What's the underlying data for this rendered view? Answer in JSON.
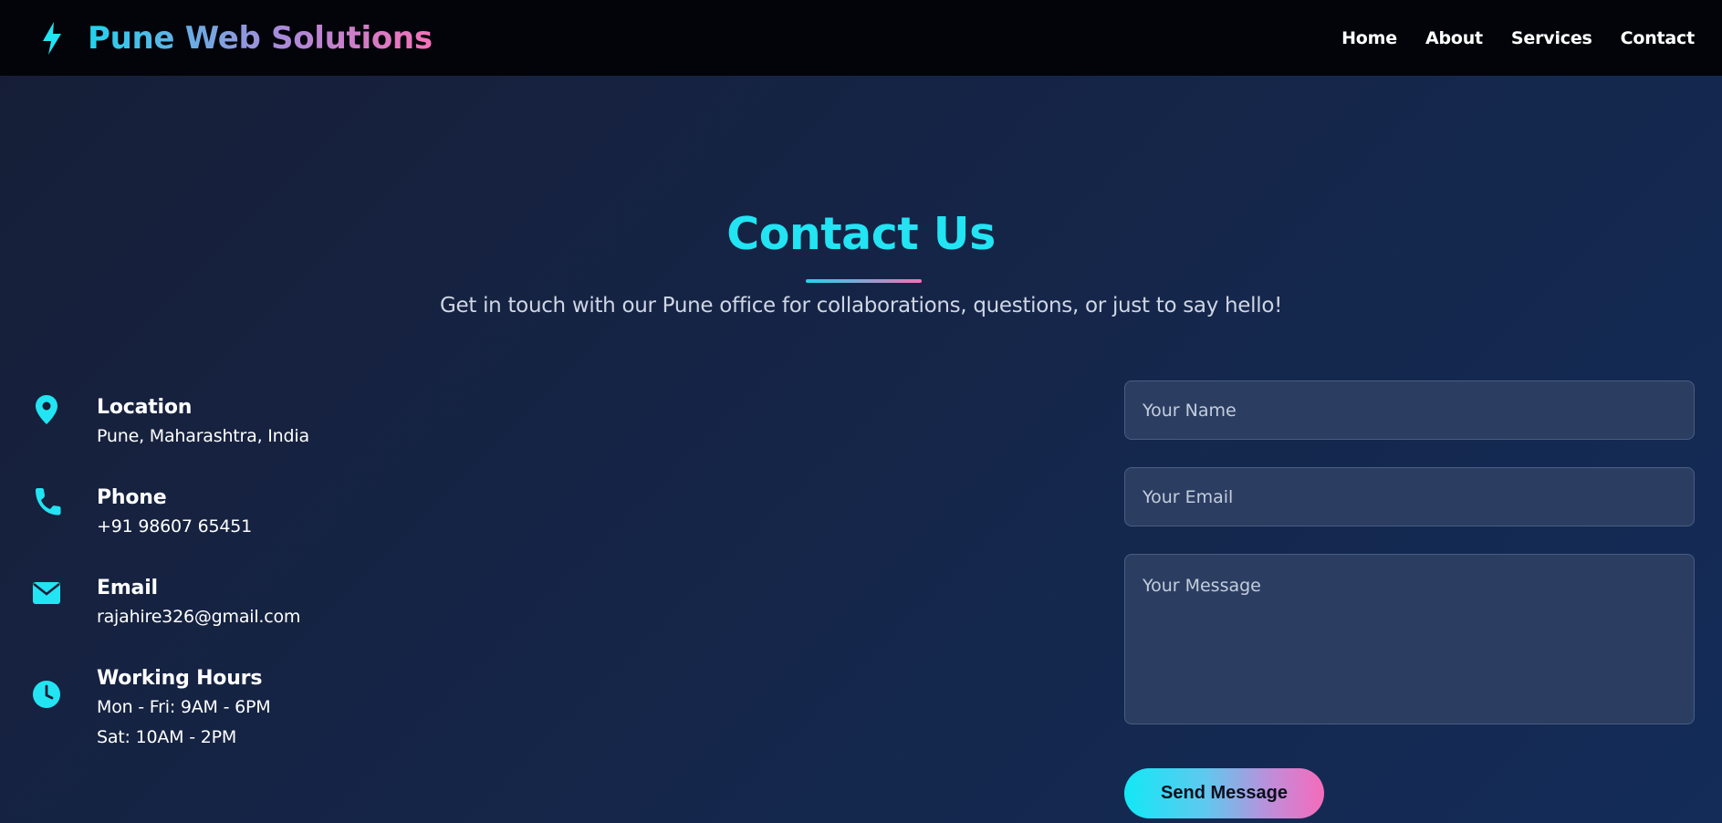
{
  "nav": {
    "brand": "Pune Web Solutions",
    "brand_icon": "lightning-bolt-icon",
    "links": [
      "Home",
      "About",
      "Services",
      "Contact"
    ]
  },
  "hero": {
    "title": "Contact Us",
    "subtitle": "Get in touch with our Pune office for collaborations, questions, or just to say hello!"
  },
  "contact_info": [
    {
      "icon": "map-pin-icon",
      "label": "Location",
      "values": [
        "Pune, Maharashtra, India"
      ]
    },
    {
      "icon": "phone-icon",
      "label": "Phone",
      "values": [
        "+91 98607 65451"
      ]
    },
    {
      "icon": "envelope-icon",
      "label": "Email",
      "values": [
        "rajahire326@gmail.com"
      ]
    },
    {
      "icon": "clock-icon",
      "label": "Working Hours",
      "values": [
        "Mon - Fri: 9AM - 6PM",
        "Sat: 10AM - 2PM"
      ]
    }
  ],
  "form": {
    "name_placeholder": "Your Name",
    "email_placeholder": "Your Email",
    "message_placeholder": "Your Message",
    "submit_label": "Send Message"
  },
  "colors": {
    "accent_cyan": "#22e4f3",
    "accent_pink": "#f472b6",
    "navbar_bg": "#020409",
    "page_bg": "#15264a"
  }
}
